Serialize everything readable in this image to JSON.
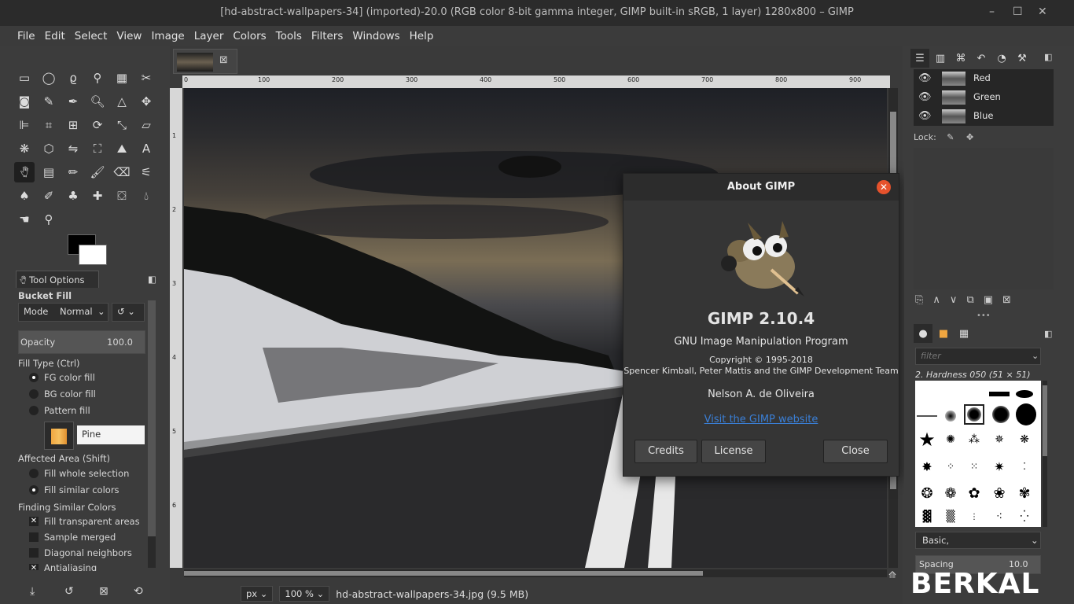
{
  "window": {
    "title": "[hd-abstract-wallpapers-34] (imported)-20.0 (RGB color 8-bit gamma integer, GIMP built-in sRGB, 1 layer) 1280x800 – GIMP",
    "controls": [
      "–",
      "☐",
      "✕"
    ]
  },
  "menu": [
    "File",
    "Edit",
    "Select",
    "View",
    "Image",
    "Layer",
    "Colors",
    "Tools",
    "Filters",
    "Windows",
    "Help"
  ],
  "tool_options": {
    "tab_label": "Tool Options",
    "tool_name": "Bucket Fill",
    "mode_label": "Mode",
    "mode_value": "Normal",
    "opacity_label": "Opacity",
    "opacity_value": "100.0",
    "fill_type_label": "Fill Type  (Ctrl)",
    "fill_types": [
      "FG color fill",
      "BG color fill",
      "Pattern fill"
    ],
    "fill_type_selected": 0,
    "pattern_name": "Pine",
    "affected_area_label": "Affected Area  (Shift)",
    "affected_areas": [
      "Fill whole selection",
      "Fill similar colors"
    ],
    "affected_selected": 1,
    "finding_label": "Finding Similar Colors",
    "finding_options": [
      {
        "label": "Fill transparent areas",
        "checked": true
      },
      {
        "label": "Sample merged",
        "checked": false
      },
      {
        "label": "Diagonal neighbors",
        "checked": false
      },
      {
        "label": "Antialiasing",
        "checked": true
      }
    ]
  },
  "ruler": {
    "h_ticks": [
      "0",
      "100",
      "200",
      "300",
      "400",
      "500",
      "600",
      "700",
      "800",
      "900"
    ],
    "v_ticks": [
      "1",
      "2",
      "3",
      "4",
      "5",
      "6"
    ]
  },
  "status": {
    "unit": "px",
    "zoom": "100 %",
    "file": "hd-abstract-wallpapers-34.jpg (9.5 MB)"
  },
  "about": {
    "title": "About GIMP",
    "version": "GIMP 2.10.4",
    "program": "GNU Image Manipulation Program",
    "copyright": "Copyright © 1995-2018",
    "authors": "Spencer Kimball, Peter Mattis and the GIMP Development Team",
    "artist": "Nelson A. de Oliveira",
    "link": "Visit the GIMP website",
    "buttons": {
      "credits": "Credits",
      "license": "License",
      "close": "Close"
    }
  },
  "channels": {
    "items": [
      "Red",
      "Green",
      "Blue"
    ],
    "lock_label": "Lock:"
  },
  "brushes": {
    "filter_placeholder": "filter",
    "current": "2. Hardness 050 (51 × 51)",
    "preset": "Basic,",
    "spacing_label": "Spacing",
    "spacing_value": "10.0"
  },
  "watermark": "BERKAL"
}
